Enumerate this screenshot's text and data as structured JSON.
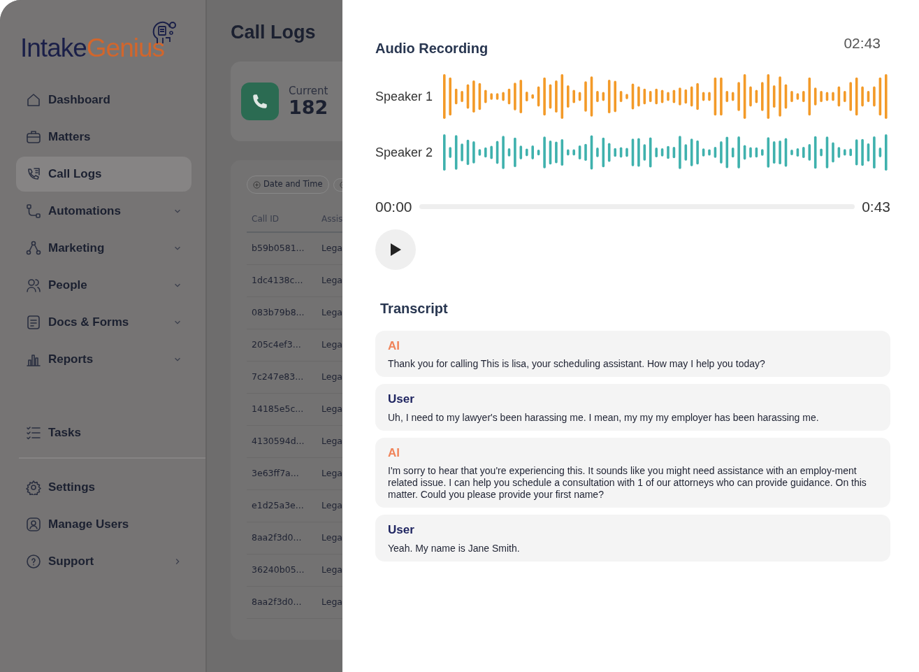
{
  "sidebar": {
    "logo": {
      "first": "Intake",
      "second": "Genius"
    },
    "groups": [
      {
        "items": [
          {
            "kind": "plain",
            "label": "Dashboard",
            "selected": false
          },
          {
            "kind": "plain",
            "label": "Matters",
            "selected": false
          },
          {
            "kind": "plain",
            "label": "Call Logs",
            "selected": true
          },
          {
            "kind": "dropdown",
            "label": "Automations",
            "selected": false
          },
          {
            "kind": "dropdown",
            "label": "Marketing",
            "selected": false
          },
          {
            "kind": "dropdown",
            "label": "People",
            "selected": false
          },
          {
            "kind": "dropdown",
            "label": "Docs & Forms",
            "selected": false
          },
          {
            "kind": "dropdown",
            "label": "Reports",
            "selected": false
          }
        ]
      },
      {
        "items": [
          {
            "kind": "plain",
            "label": "Tasks",
            "selected": false
          }
        ]
      },
      {
        "items": [
          {
            "kind": "plain",
            "label": "Settings",
            "selected": false
          },
          {
            "kind": "plain",
            "label": "Manage Users",
            "selected": false
          },
          {
            "kind": "link",
            "label": "Support",
            "selected": false
          }
        ]
      }
    ]
  },
  "main": {
    "title": "Call Logs",
    "stat": {
      "label": "Current",
      "value": "182"
    },
    "filters": [
      {
        "label": "Date and Time",
        "cut_off": false
      },
      {
        "cut_off": true
      }
    ],
    "table": {
      "columns": [
        "Call ID",
        "Assis"
      ],
      "rows": [
        [
          "b59b0581...",
          "Lega"
        ],
        [
          "1dc4138c...",
          "Lega"
        ],
        [
          "083b79b8...",
          "Lega"
        ],
        [
          "205c4ef3...",
          "Lega"
        ],
        [
          "7c247e83...",
          "Lega"
        ],
        [
          "14185e5c...",
          "Lega"
        ],
        [
          "4130594d...",
          "Lega"
        ],
        [
          "3e63ff7a...",
          "Lega"
        ],
        [
          "e1d25a3e...",
          "Lega"
        ],
        [
          "8aa2f3d0...",
          "Lega"
        ],
        [
          "36240b05...",
          "Lega"
        ],
        [
          "8aa2f3d0...",
          "Lega"
        ]
      ]
    }
  },
  "panel": {
    "title": "Audio Recording",
    "duration": "02:43",
    "speakers": [
      {
        "name": "Speaker 1",
        "color": "#f39a28"
      },
      {
        "name": "Speaker 2",
        "color": "#3fb1ad"
      }
    ],
    "player": {
      "start": "00:00",
      "end": "0:43",
      "level": 0
    },
    "transcript_title": "Transcript",
    "messages": [
      {
        "kind": "ai",
        "speaker": "AI",
        "text": "Thank you for calling This is lisa, your scheduling assistant. How may I help you today?"
      },
      {
        "kind": "user",
        "speaker": "User",
        "text": "Uh, I need to my lawyer's been harassing me. I mean, my my my employer has been harassing me."
      },
      {
        "kind": "ai",
        "speaker": "AI",
        "text": "I'm sorry to hear that you're experiencing this. It sounds like you might need assistance with an employ-ment related issue. I can help you schedule a consultation with 1 of our attorneys who can provide guidance. On this matter. Could you please provide your first name?"
      },
      {
        "kind": "user",
        "speaker": "User",
        "text": "Yeah. My name is Jane Smith."
      }
    ]
  }
}
